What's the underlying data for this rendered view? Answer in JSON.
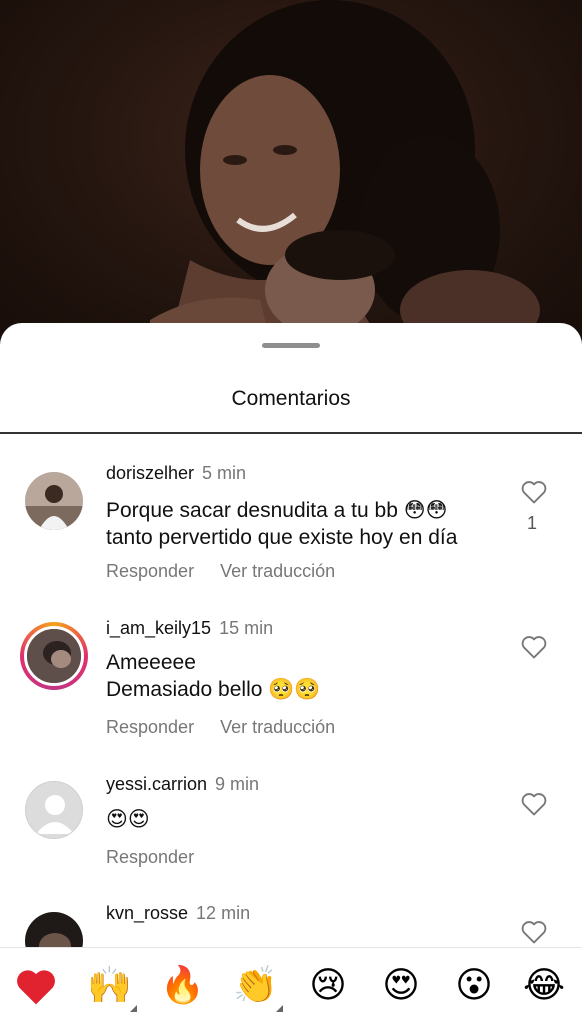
{
  "sheet": {
    "title": "Comentarios"
  },
  "comments": [
    {
      "username": "doriszelher",
      "time": "5 min",
      "lines": [
        "Porque sacar desnudita a tu bb 😳😳",
        "tanto pervertido que existe hoy en día"
      ],
      "reply": "Responder",
      "translate": "Ver traducción",
      "likes": "1"
    },
    {
      "username": "i_am_keily15",
      "time": "15 min",
      "lines": [
        "Ameeeee",
        "Demasiado  bello 🥺🥺"
      ],
      "reply": "Responder",
      "translate": "Ver traducción"
    },
    {
      "username": "yessi.carrion",
      "time": "9 min",
      "lines": [
        "😍😍"
      ],
      "reply": "Responder"
    },
    {
      "username": "kvn_rosse",
      "time": "12 min"
    }
  ],
  "reactions": [
    "❤️",
    "🙌",
    "🔥",
    "👏",
    "😢",
    "😍",
    "😮",
    "😂"
  ],
  "icons": {
    "like": "heart-outline-icon"
  },
  "colors": {
    "ring_start": "#f6a21a",
    "ring_end": "#c13584",
    "heart": "#e0232e"
  }
}
